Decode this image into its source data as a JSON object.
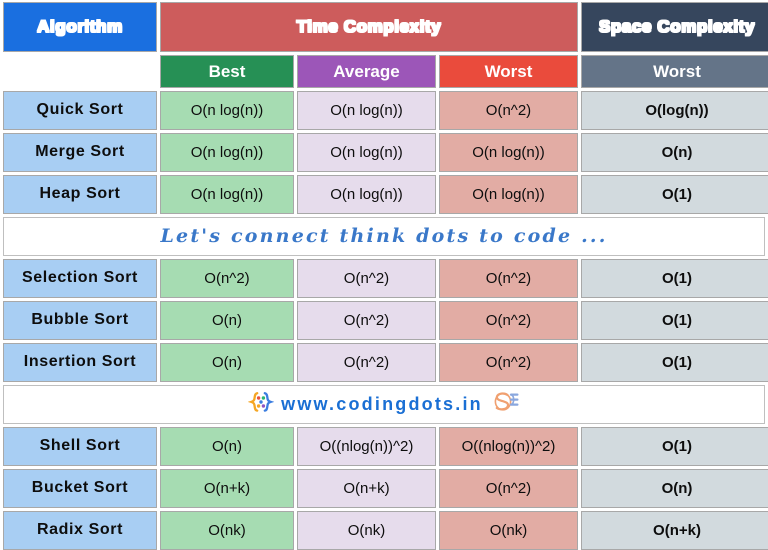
{
  "table": {
    "header_top": {
      "algorithm": "Algorithm",
      "time_complexity": "Time Complexity",
      "space_complexity": "Space Complexity"
    },
    "header_sub": {
      "best": "Best",
      "average": "Average",
      "time_worst": "Worst",
      "space_worst": "Worst"
    },
    "rows": [
      {
        "algorithm": "Quick Sort",
        "best": "O(n log(n))",
        "average": "O(n log(n))",
        "worst": "O(n^2)",
        "space": "O(log(n))"
      },
      {
        "algorithm": "Merge Sort",
        "best": "O(n log(n))",
        "average": "O(n log(n))",
        "worst": "O(n log(n))",
        "space": "O(n)"
      },
      {
        "algorithm": "Heap Sort",
        "best": "O(n log(n))",
        "average": "O(n log(n))",
        "worst": "O(n log(n))",
        "space": "O(1)"
      },
      {
        "algorithm": "Selection Sort",
        "best": "O(n^2)",
        "average": "O(n^2)",
        "worst": "O(n^2)",
        "space": "O(1)"
      },
      {
        "algorithm": "Bubble Sort",
        "best": "O(n)",
        "average": "O(n^2)",
        "worst": "O(n^2)",
        "space": "O(1)"
      },
      {
        "algorithm": "Insertion Sort",
        "best": "O(n)",
        "average": "O(n^2)",
        "worst": "O(n^2)",
        "space": "O(1)"
      },
      {
        "algorithm": "Shell Sort",
        "best": "O(n)",
        "average": "O((nlog(n))^2)",
        "worst": "O((nlog(n))^2)",
        "space": "O(1)"
      },
      {
        "algorithm": "Bucket Sort",
        "best": "O(n+k)",
        "average": "O(n+k)",
        "worst": "O(n^2)",
        "space": "O(n)"
      },
      {
        "algorithm": "Radix Sort",
        "best": "O(nk)",
        "average": "O(nk)",
        "worst": "O(nk)",
        "space": "O(n+k)"
      }
    ]
  },
  "banners": {
    "tagline": "Let's connect think dots to code ...",
    "site_url": "www.codingdots.in"
  },
  "colors": {
    "algorithm_header": "#1a6fe0",
    "time_header": "#cd5c5c",
    "space_header": "#36465d",
    "best_header": "#269055",
    "average_header": "#9c56b8",
    "worst_header": "#ea4b3c",
    "space_worst_header": "#647488",
    "algorithm_cell": "#a8cef3",
    "best_cell": "#a6dcb2",
    "average_cell": "#e6dcec",
    "worst_cell": "#e2aca4",
    "space_cell": "#d2dade",
    "tagline_text": "#3a78c9",
    "site_url_text": "#1a6fd4"
  }
}
